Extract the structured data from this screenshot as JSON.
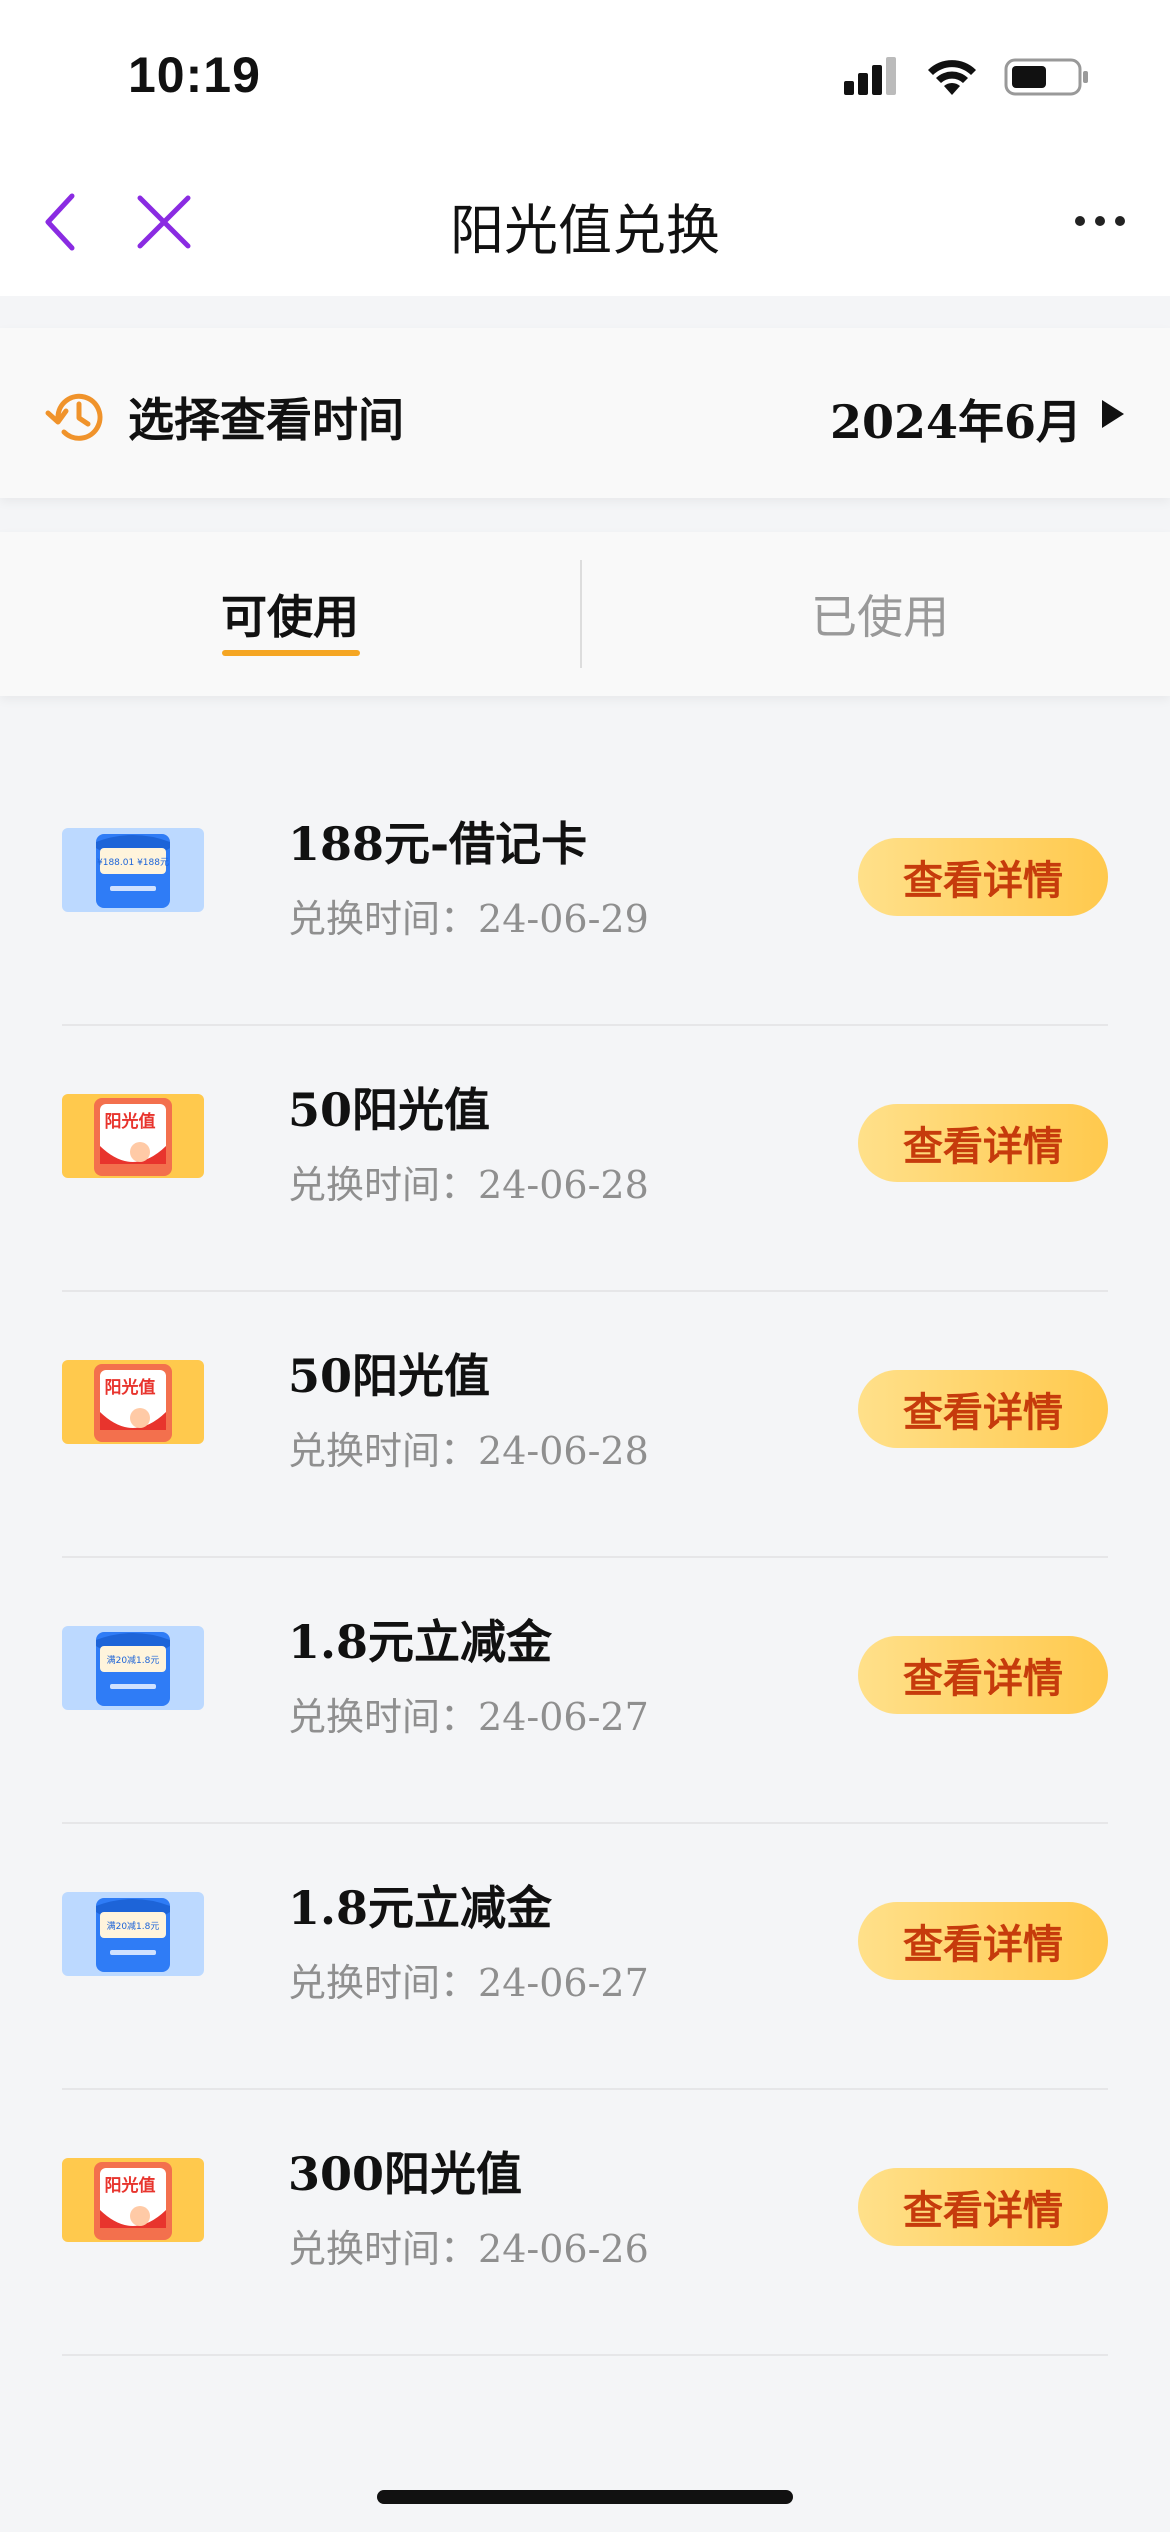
{
  "status_bar": {
    "time": "10:19"
  },
  "nav": {
    "title": "阳光值兑换"
  },
  "time_filter": {
    "label": "选择查看时间",
    "value": "2024年6月"
  },
  "tabs": [
    {
      "label": "可使用",
      "active": true
    },
    {
      "label": "已使用",
      "active": false
    }
  ],
  "items": [
    {
      "title": "188元-借记卡",
      "time_prefix": "兑换时间：",
      "date": "24-06-29",
      "button": "查看详情",
      "thumb_type": "blue-envelope",
      "thumb_text": "¥188.01 ¥188元"
    },
    {
      "title": "50阳光值",
      "time_prefix": "兑换时间：",
      "date": "24-06-28",
      "button": "查看详情",
      "thumb_type": "sunshine",
      "thumb_text": "阳光值"
    },
    {
      "title": "50阳光值",
      "time_prefix": "兑换时间：",
      "date": "24-06-28",
      "button": "查看详情",
      "thumb_type": "sunshine",
      "thumb_text": "阳光值"
    },
    {
      "title": "1.8元立减金",
      "time_prefix": "兑换时间：",
      "date": "24-06-27",
      "button": "查看详情",
      "thumb_type": "blue-envelope",
      "thumb_text": "满20减1.8元"
    },
    {
      "title": "1.8元立减金",
      "time_prefix": "兑换时间：",
      "date": "24-06-27",
      "button": "查看详情",
      "thumb_type": "blue-envelope",
      "thumb_text": "满20减1.8元"
    },
    {
      "title": "300阳光值",
      "time_prefix": "兑换时间：",
      "date": "24-06-26",
      "button": "查看详情",
      "thumb_type": "sunshine",
      "thumb_text": "阳光值"
    }
  ],
  "colors": {
    "accent": "#f5a623",
    "button_text": "#c63b0c",
    "nav_icon": "#8a2be2",
    "muted_text": "#8f8f8f"
  },
  "icons": [
    "signal-icon",
    "wifi-icon",
    "battery-icon",
    "back-arrow-icon",
    "close-icon",
    "more-icon",
    "clock-history-icon",
    "triangle-right-icon"
  ]
}
